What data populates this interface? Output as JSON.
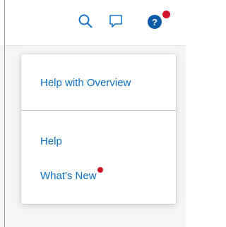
{
  "header": {
    "icons": {
      "search": "search-icon",
      "feedback": "feedback-icon",
      "help": "help-icon"
    },
    "help_has_notification": true
  },
  "help_menu": {
    "items": [
      {
        "label": "Help with Overview"
      },
      {
        "label": "Help"
      },
      {
        "label": "What's New",
        "has_notification": true
      }
    ]
  },
  "colors": {
    "accent": "#0b6fc1",
    "notification": "#d3122a",
    "icon": "#1976c8",
    "help_icon_bg": "#0b5ca8"
  }
}
